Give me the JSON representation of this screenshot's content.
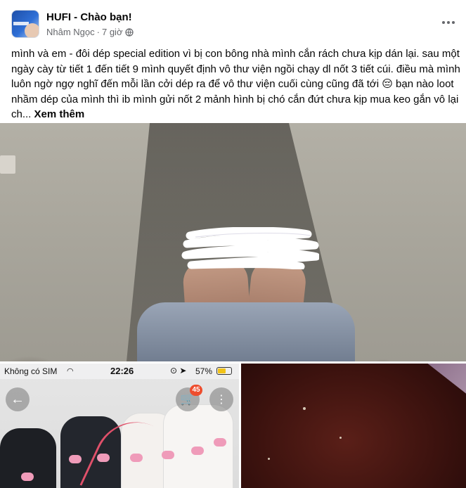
{
  "post": {
    "group_name": "HUFI - Chào bạn!",
    "author": "Nhâm Ngọc",
    "separator": "·",
    "time": "7 giờ",
    "privacy_icon": "globe-icon",
    "more_icon": "more-horizontal-icon",
    "body_text": "mình và em - đôi dép special edition vì bị con bông nhà mình cắn rách chưa kịp dán lại. sau một ngày cày từ tiết 1 đến tiết 9 mình quyết định vô thư viện ngồi chạy dl nốt 3 tiết cúi. điều mà mình luôn ngờ ngợ nghĩ đến mỗi lần cởi dép ra để vô thư viện cuối cùng cũng đã tới 😔 bạn nào loot nhầm dép của mình thì ib mình gửi nốt 2 mảnh hình bị chó cắn đứt chưa kịp mua keo gắn vô lại ch...",
    "see_more": "Xem thêm"
  },
  "photos": {
    "main_alt_icon": "photo-icon",
    "phone_screenshot": {
      "carrier": "Không có SIM",
      "wifi_icon": "wifi-icon",
      "time": "22:26",
      "lock_icon": "orientation-lock-icon",
      "location_icon": "location-arrow-icon",
      "battery": "57%",
      "back_icon": "arrow-left-icon",
      "cart_icon": "cart-icon",
      "cart_count": "45",
      "menu_icon": "vertical-dots-icon"
    }
  },
  "colors": {
    "text": "#050505",
    "secondary_text": "#65676b",
    "cart_badge": "#ee4d2d"
  }
}
